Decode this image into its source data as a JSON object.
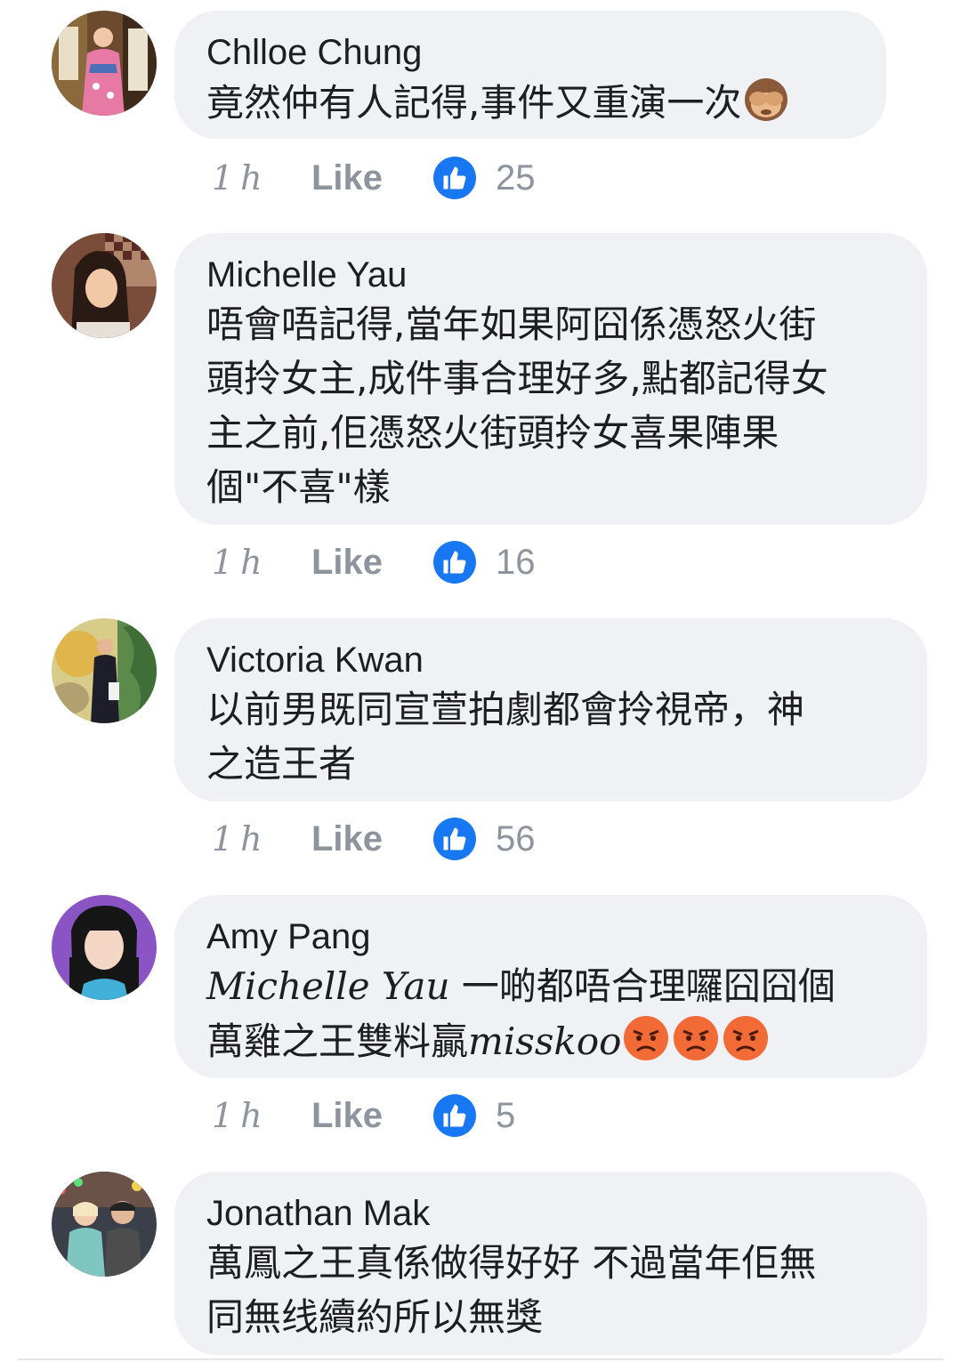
{
  "colors": {
    "accent": "#1877f2",
    "bubble": "#f0f1f4",
    "meta": "#8d949e",
    "text": "#1c1e21"
  },
  "comments": [
    {
      "author": "Chlloe Chung",
      "lines": [
        "竟然仲有人記得,事件又重演一次"
      ],
      "emoji": "see-no-evil-monkey",
      "time": "1h",
      "like_label": "Like",
      "likes": "25"
    },
    {
      "author": "Michelle Yau",
      "lines": [
        "唔會唔記得,當年如果阿囧係憑怒火街",
        "頭拎女主,成件事合理好多,點都記得女",
        "主之前,佢憑怒火街頭拎女喜果陣果",
        "個\"不喜\"樣"
      ],
      "time": "1h",
      "like_label": "Like",
      "likes": "16"
    },
    {
      "author": "Victoria Kwan",
      "lines": [
        "以前男既同宣萱拍劇都會拎視帝，神",
        "之造王者"
      ],
      "time": "1h",
      "like_label": "Like",
      "likes": "56"
    },
    {
      "author": "Amy Pang",
      "mention": "Michelle Yau",
      "line1_rest": " 一啲都唔合理囉囧囧個",
      "line2_text": "萬雞之王雙料贏",
      "line2_script": "misskoo",
      "emoji": "angry-face",
      "time": "1h",
      "like_label": "Like",
      "likes": "5"
    },
    {
      "author": "Jonathan Mak",
      "lines": [
        "萬鳳之王真係做得好好 不過當年佢無",
        "同無线續約所以無獎"
      ]
    }
  ]
}
